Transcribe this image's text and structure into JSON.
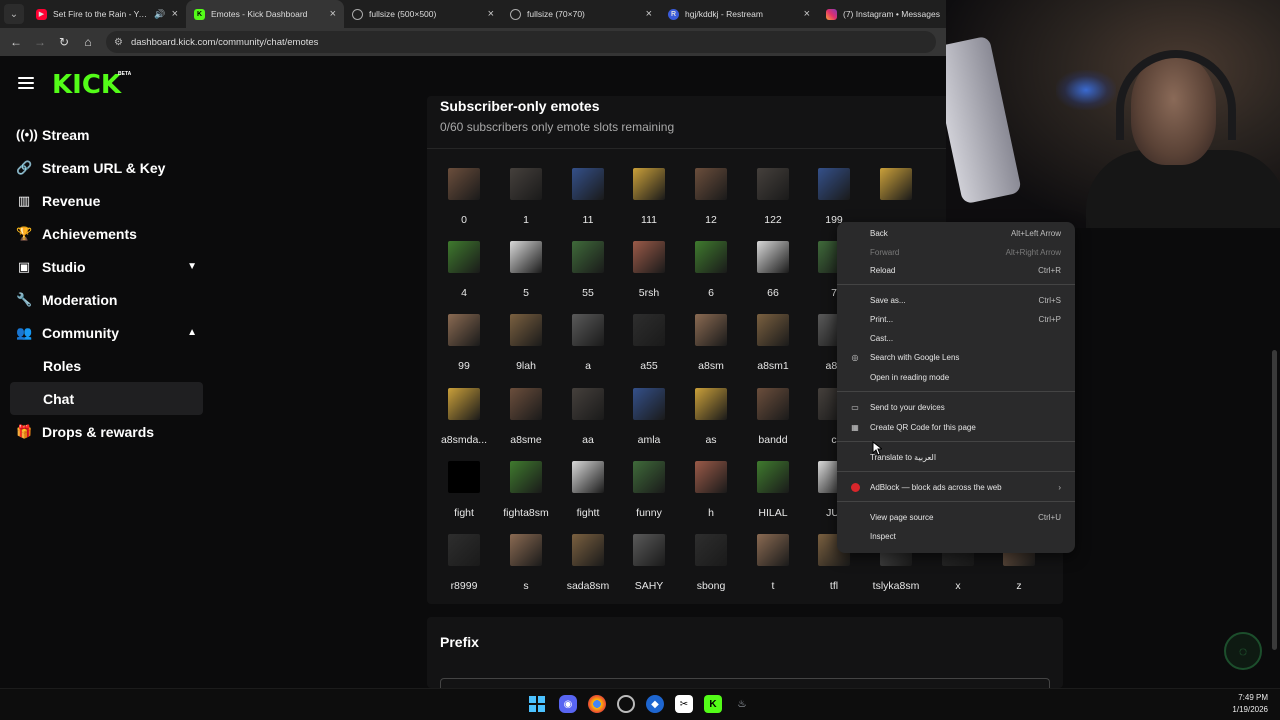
{
  "browser": {
    "tabs": [
      {
        "title": "Set Fire to the Rain - YouTube",
        "favicon": "youtube-icon",
        "color": "#ff0033",
        "active": false,
        "audio": true
      },
      {
        "title": "Emotes - Kick Dashboard",
        "favicon": "kick-icon",
        "color": "#53fc18",
        "active": true
      },
      {
        "title": "fullsize (500×500)",
        "favicon": "globe-icon",
        "color": "#888888",
        "active": false
      },
      {
        "title": "fullsize (70×70)",
        "favicon": "globe-icon",
        "color": "#888888",
        "active": false
      },
      {
        "title": "hgj/kddkj - Restream",
        "favicon": "restream-icon",
        "color": "#3a5bd9",
        "active": false
      },
      {
        "title": "(7) Instagram • Messages",
        "favicon": "instagram-icon",
        "color": "#e1306c",
        "active": false
      }
    ],
    "url": "dashboard.kick.com/community/chat/emotes"
  },
  "app": {
    "logo": "KICK",
    "beta": "BETA",
    "nav": [
      {
        "label": "Stream",
        "icon": "broadcast-icon"
      },
      {
        "label": "Stream URL & Key",
        "icon": "link-icon"
      },
      {
        "label": "Revenue",
        "icon": "chart-icon"
      },
      {
        "label": "Achievements",
        "icon": "trophy-icon"
      },
      {
        "label": "Studio",
        "icon": "film-icon",
        "chevron": "down"
      },
      {
        "label": "Moderation",
        "icon": "wrench-icon"
      },
      {
        "label": "Community",
        "icon": "people-icon",
        "chevron": "up"
      }
    ],
    "community_sub": [
      {
        "label": "Roles",
        "active": false
      },
      {
        "label": "Chat",
        "active": true
      }
    ],
    "nav_last": {
      "label": "Drops & rewards",
      "icon": "gift-icon"
    }
  },
  "emotes_panel": {
    "title": "Subscriber-only emotes",
    "subtitle": "0/60 subscribers only emote slots remaining",
    "rows": [
      [
        "0",
        "1",
        "11",
        "111",
        "12",
        "122",
        "199",
        ""
      ],
      [
        "4",
        "5",
        "55",
        "5rsh",
        "6",
        "66",
        "7"
      ],
      [
        "99",
        "9lah",
        "a",
        "a55",
        "a8sm",
        "a8sm1",
        "a8s"
      ],
      [
        "a8smda...",
        "a8sme",
        "aa",
        "amla",
        "as",
        "bandd",
        "c"
      ],
      [
        "fight",
        "fighta8sm",
        "fightt",
        "funny",
        "h",
        "HILAL",
        "JUI"
      ],
      [
        "r8999",
        "s",
        "sada8sm",
        "SAHY",
        "sbong",
        "t",
        "tfl",
        "tslyka8sm",
        "x",
        "z"
      ]
    ]
  },
  "prefix": {
    "title": "Prefix"
  },
  "context_menu": {
    "items": [
      {
        "label": "Back",
        "shortcut": "Alt+Left Arrow",
        "disabled": false
      },
      {
        "label": "Forward",
        "shortcut": "Alt+Right Arrow",
        "disabled": true
      },
      {
        "label": "Reload",
        "shortcut": "Ctrl+R",
        "disabled": false
      },
      {
        "label": "Save as...",
        "shortcut": "Ctrl+S",
        "disabled": false
      },
      {
        "label": "Print...",
        "shortcut": "Ctrl+P",
        "disabled": false
      },
      {
        "label": "Cast...",
        "shortcut": "",
        "disabled": false
      },
      {
        "label": "Search with Google Lens",
        "shortcut": "",
        "icon": "lens-icon"
      },
      {
        "label": "Open in reading mode",
        "shortcut": ""
      },
      {
        "label": "Send to your devices",
        "shortcut": "",
        "icon": "devices-icon"
      },
      {
        "label": "Create QR Code for this page",
        "shortcut": "",
        "icon": "qr-icon"
      },
      {
        "label": "Translate to العربية",
        "shortcut": "",
        "icon": "translate-icon"
      },
      {
        "label": "AdBlock — block ads across the web",
        "shortcut": "›",
        "icon": "adblock-icon"
      },
      {
        "label": "View page source",
        "shortcut": "Ctrl+U"
      },
      {
        "label": "Inspect",
        "shortcut": ""
      }
    ]
  },
  "taskbar": {
    "time": "7:49 PM",
    "date": "1/19/2026"
  }
}
